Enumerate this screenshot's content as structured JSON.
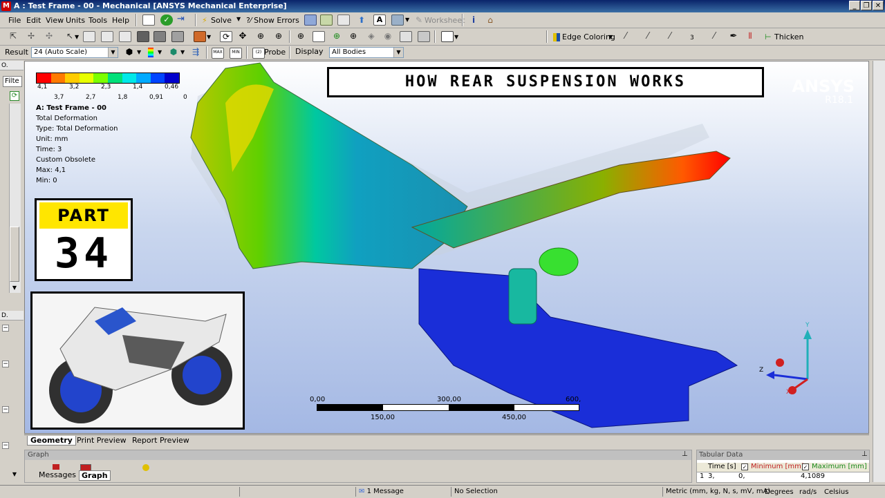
{
  "window": {
    "title": "A : Test Frame - 00 - Mechanical [ANSYS Mechanical Enterprise]"
  },
  "menu": [
    "File",
    "Edit",
    "View",
    "Units",
    "Tools",
    "Help"
  ],
  "toolbar1": {
    "solve": "Solve",
    "show_errors": "?⁄ Show Errors",
    "worksheet": "Worksheet"
  },
  "toolbar2": {
    "edge_coloring": "Edge Coloring",
    "thicken": "Thicken",
    "three": "3"
  },
  "toolbar3": {
    "result_label": "Result",
    "result_value": "24 (Auto Scale)",
    "probe": "Probe",
    "display_label": "Display",
    "display_value": "All Bodies"
  },
  "leftpanel": {
    "filter": "Filte"
  },
  "legend": {
    "colors": [
      "#ff0000",
      "#ff7a00",
      "#ffcc00",
      "#e8ff00",
      "#7cff00",
      "#00e07a",
      "#00e8e8",
      "#00aaff",
      "#0044ff",
      "#0000cc"
    ],
    "top_labels": [
      "4,1",
      "3,2",
      "2,3",
      "1,4",
      "0,46"
    ],
    "bottom_labels": [
      "3,7",
      "2,7",
      "1,8",
      "0,91",
      "0"
    ],
    "title": "A: Test Frame - 00",
    "lines": [
      "Total Deformation",
      "Type: Total Deformation",
      "Unit: mm",
      "Time: 3",
      "Custom Obsolete",
      "Max: 4,1",
      "Min: 0"
    ]
  },
  "headline": "HOW REAR SUSPENSION WORKS",
  "brand": {
    "name": "ANSYS",
    "version": "R18.1"
  },
  "part": {
    "label": "PART",
    "number": "34"
  },
  "scale": {
    "top": [
      "0,00",
      "300,00",
      "600,"
    ],
    "bottom": [
      "150,00",
      "450,00"
    ]
  },
  "axes": {
    "x": "X",
    "y": "Y",
    "z": "Z"
  },
  "view_tabs": [
    "Geometry",
    "Print Preview",
    "Report Preview"
  ],
  "graph_panel": {
    "title": "Graph"
  },
  "bottom_tabs": [
    "Messages",
    "Graph"
  ],
  "tabular": {
    "title": "Tabular Data",
    "headers": [
      "Time [s]",
      "Minimum [mm]",
      "Maximum [mm]"
    ],
    "row": [
      "1",
      "3,",
      "0,",
      "4,1089"
    ]
  },
  "status": {
    "messages": "1 Message",
    "selection": "No Selection",
    "units": "Metric (mm, kg, N, s, mV, mA)",
    "angle": "Degrees",
    "rot": "rad/s",
    "temp": "Celsius"
  }
}
